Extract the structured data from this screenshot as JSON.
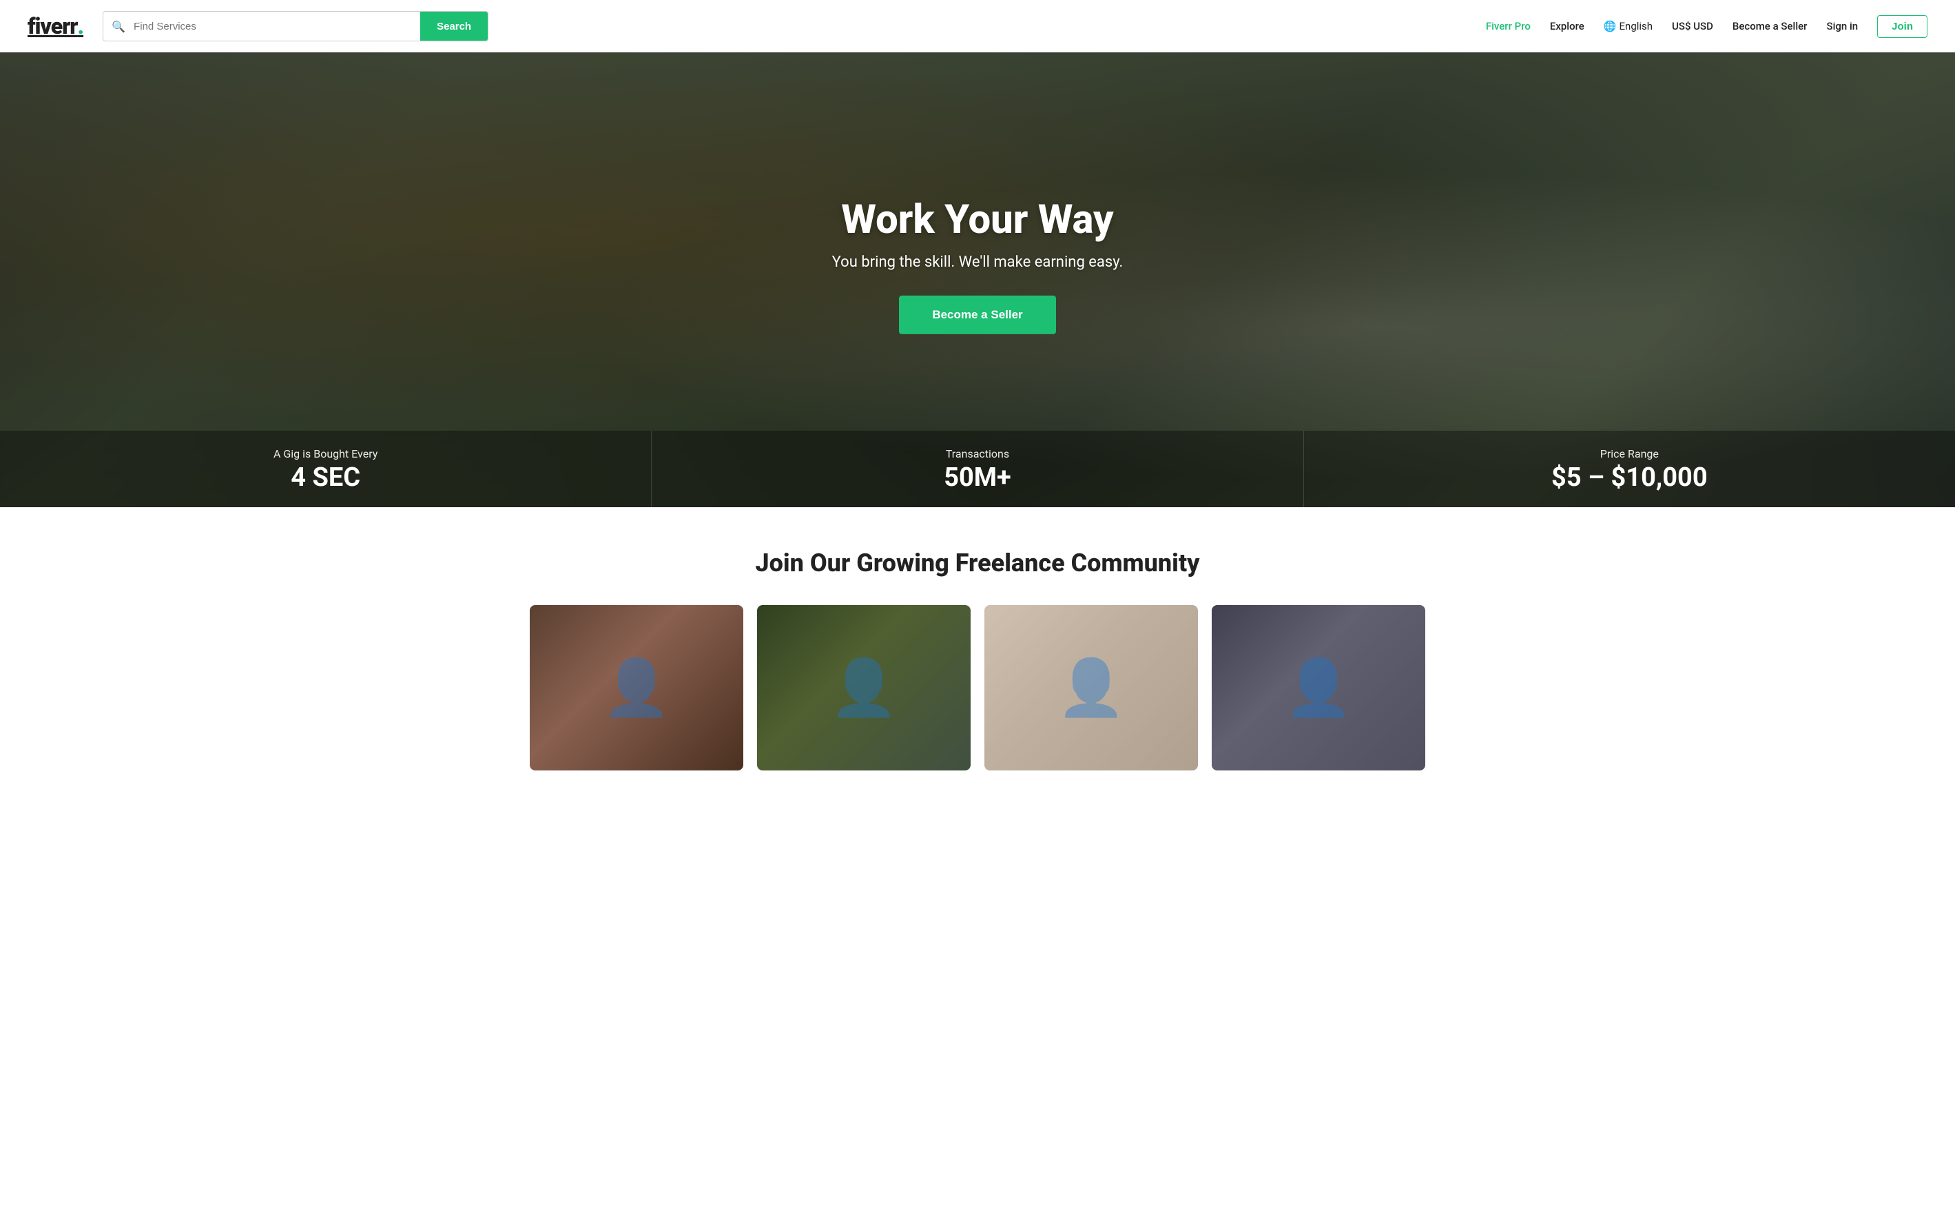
{
  "navbar": {
    "logo_text": "fiverr",
    "logo_dot": ".",
    "search_placeholder": "Find Services",
    "search_button_label": "Search",
    "nav_pro_label": "Fiverr Pro",
    "nav_explore_label": "Explore",
    "nav_lang_label": "English",
    "nav_currency_label": "US$ USD",
    "nav_become_seller_label": "Become a Seller",
    "nav_signin_label": "Sign in",
    "nav_join_label": "Join"
  },
  "hero": {
    "headline": "Work Your Way",
    "subheadline": "You bring the skill. We'll make earning easy.",
    "cta_label": "Become a Seller"
  },
  "stats": [
    {
      "label": "A Gig is Bought Every",
      "value": "4 SEC"
    },
    {
      "label": "Transactions",
      "value": "50M+"
    },
    {
      "label": "Price Range",
      "value": "$5 – $10,000"
    }
  ],
  "community": {
    "heading": "Join Our Growing Freelance Community",
    "cards": [
      {
        "id": 1,
        "alt": "Freelancer 1"
      },
      {
        "id": 2,
        "alt": "Freelancer 2"
      },
      {
        "id": 3,
        "alt": "Freelancer 3"
      },
      {
        "id": 4,
        "alt": "Freelancer 4"
      }
    ]
  }
}
